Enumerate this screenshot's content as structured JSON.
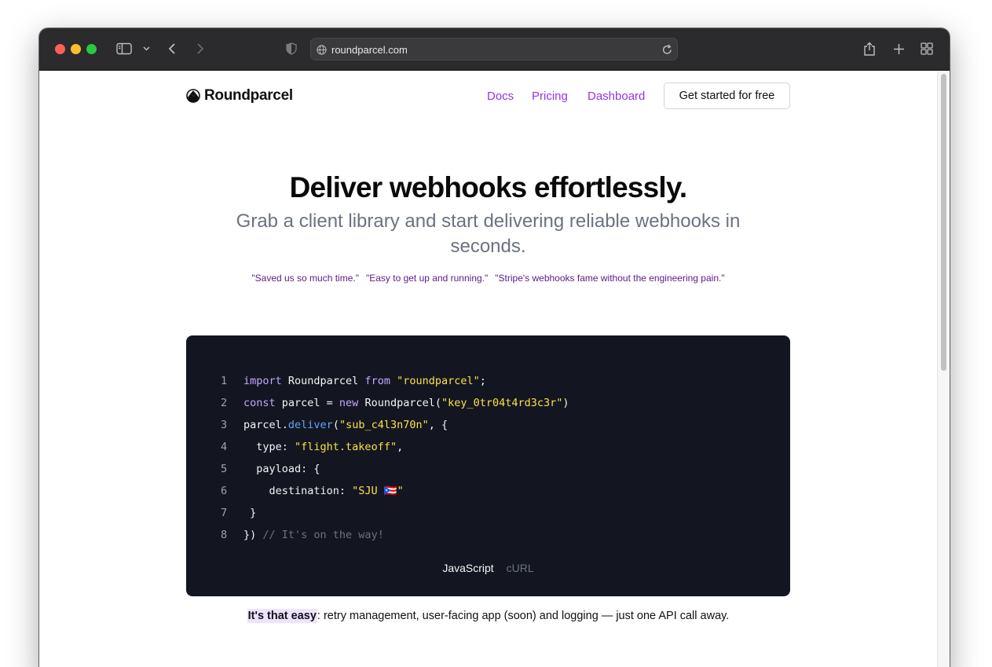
{
  "browser": {
    "url": "roundparcel.com"
  },
  "nav": {
    "brand": "Roundparcel",
    "links": [
      "Docs",
      "Pricing",
      "Dashboard"
    ],
    "cta": "Get started for free"
  },
  "hero": {
    "title": "Deliver webhooks effortlessly.",
    "subtitle": "Grab a client library and start delivering reliable webhooks in seconds.",
    "quotes": [
      "\"Saved us so much time.\"",
      "\"Easy to get up and running.\"",
      "\"Stripe's webhooks fame without the engineering pain.\""
    ]
  },
  "code": {
    "line_numbers": [
      "1",
      "2",
      "3",
      "4",
      "5",
      "6",
      "7",
      "8"
    ],
    "tokens": {
      "l1_import": "import",
      "l1_name": " Roundparcel ",
      "l1_from": "from",
      "l1_space": " ",
      "l1_str": "\"roundparcel\"",
      "l1_end": ";",
      "l2_const": "const",
      "l2_mid": " parcel = ",
      "l2_new": "new",
      "l2_call": " Roundparcel(",
      "l2_str": "\"key_0tr04t4rd3c3r\"",
      "l2_end": ")",
      "l3_obj": "parcel.",
      "l3_fn": "deliver",
      "l3_open": "(",
      "l3_str": "\"sub_c4l3n70n\"",
      "l3_end": ", {",
      "l4_key": "  type: ",
      "l4_str": "\"flight.takeoff\"",
      "l4_end": ",",
      "l5_key": "  payload: {",
      "l6_key": "    destination: ",
      "l6_str": "\"SJU 🇵🇷\"",
      "l7": " }",
      "l8_close": "})",
      "l8_comment": " // It's on the way!"
    },
    "tabs": [
      "JavaScript",
      "cURL"
    ],
    "active_tab": "JavaScript"
  },
  "tagline": {
    "highlight": "It's that easy",
    "rest": ": retry management, user-facing app (soon) and logging — just one API call away."
  },
  "colors": {
    "accent": "#9333ea",
    "code_bg": "#131621",
    "keyword": "#c4a5ff",
    "string": "#fde047",
    "function": "#60a5fa"
  }
}
